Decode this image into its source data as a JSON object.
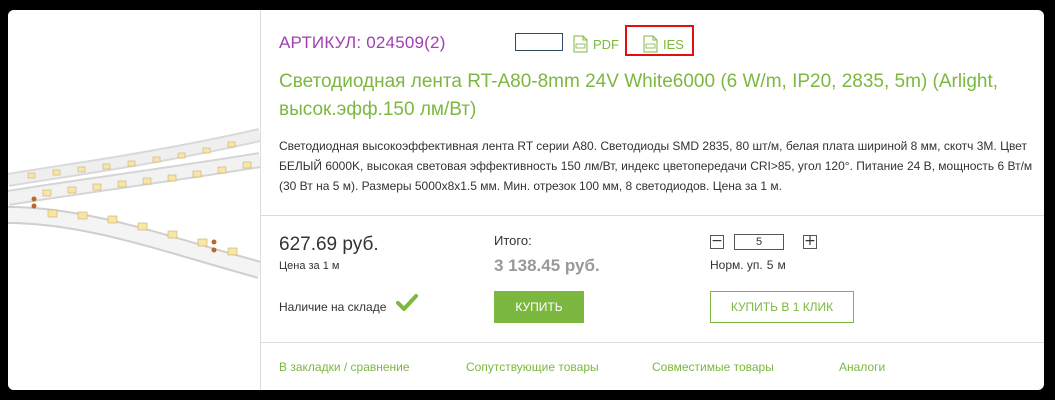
{
  "product": {
    "article": "АРТИКУЛ: 024509(2)",
    "title": "Светодиодная лента RT-A80-8mm 24V White6000 (6 W/m, IP20, 2835, 5m) (Arlight, высок.эфф.150 лм/Вт)",
    "description": "Светодиодная высокоэффективная лента RT серии A80. Светодиоды SMD 2835, 80 шт/м, белая плата шириной 8 мм, скотч 3M. Цвет БЕЛЫЙ 6000K, высокая световая эффективность 150 лм/Вт, индекс цветопередачи CRI>85, угол 120°. Питание 24 В, мощность 6 Вт/м (30 Вт на 5 м). Размеры 5000x8x1.5 мм. Мин. отрезок 100 мм, 8 светодиодов. Цена за 1 м."
  },
  "docs": {
    "pdf_label": "PDF",
    "ies_label": "IES"
  },
  "pricing": {
    "price": "627.69 руб.",
    "price_unit": "Цена за 1 м",
    "stock": "Наличие на складе",
    "total_label": "Итого:",
    "total_value": "3 138.45 руб.",
    "buy_label": "КУПИТЬ",
    "one_click_label": "КУПИТЬ В 1 КЛИК"
  },
  "quantity": {
    "minus": "−",
    "plus": "+",
    "value": "5",
    "norm_label": "Норм. уп.",
    "norm_value": "5",
    "norm_unit": "м"
  },
  "links": {
    "bookmarks": "В закладки / сравнение",
    "related": "Сопутствующие товары",
    "compatible": "Совместимые товары",
    "analogs": "Аналоги"
  },
  "colors": {
    "accent_green": "#7cb83f",
    "article_purple": "#a03fb2",
    "highlight_red": "#e01010"
  }
}
